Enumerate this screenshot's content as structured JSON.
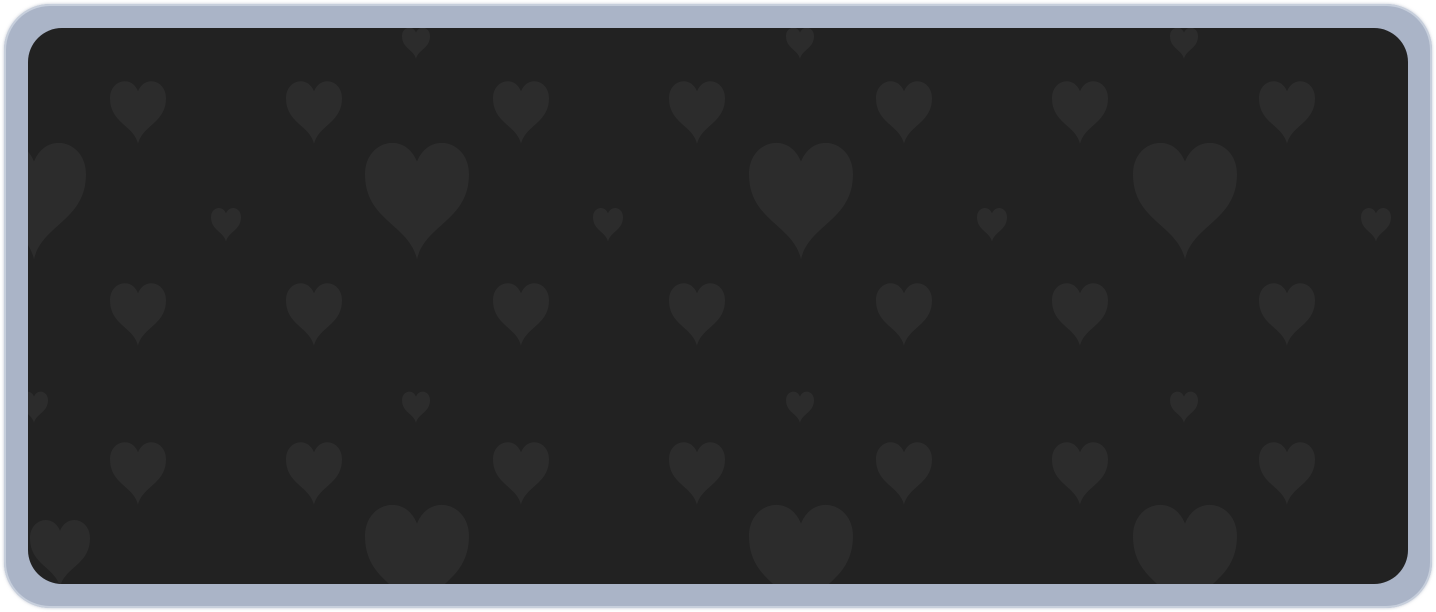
{
  "window": {
    "frame_color": "#aab4c7",
    "panel_color": "#222222",
    "pattern_icon": "heart-icon",
    "pattern_color": "#2c2c2c"
  }
}
